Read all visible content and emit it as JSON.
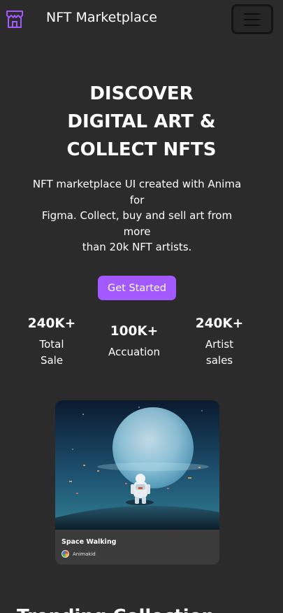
{
  "header": {
    "brand": "NFT Marketplace",
    "logo_icon": "storefront-icon",
    "menu_icon": "hamburger-menu-icon",
    "accent_color": "#a259ff"
  },
  "hero": {
    "title_lines": [
      "DISCOVER",
      "DIGITAL ART &",
      "COLLECT NFTS"
    ],
    "subtitle_lines": [
      "NFT marketplace UI created with Anima",
      "for",
      "Figma. Collect, buy and sell art from",
      "more",
      "than 20k NFT artists."
    ],
    "cta_label": "Get Started"
  },
  "stats": [
    {
      "value": "240K+",
      "label_lines": [
        "Total",
        "Sale"
      ]
    },
    {
      "value": "100K+",
      "label_lines": [
        "Accuation"
      ]
    },
    {
      "value": "240K+",
      "label_lines": [
        "Artist",
        "sales"
      ]
    }
  ],
  "featured_card": {
    "title": "Space Walking",
    "artist": "Animakid",
    "avatar_icon": "artist-avatar"
  },
  "section": {
    "title": "Trending Collection"
  },
  "colors": {
    "background": "#2b2b2b",
    "card": "#3b3b3b",
    "button": "#a259ff"
  }
}
